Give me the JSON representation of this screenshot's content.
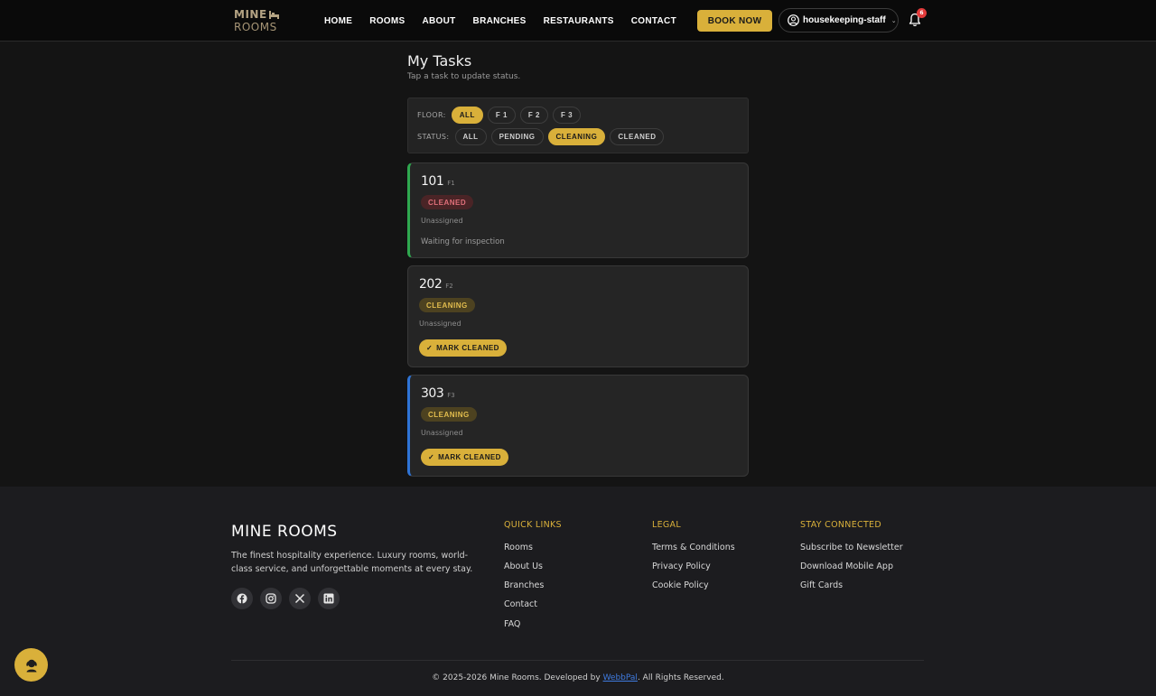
{
  "header": {
    "logo_top": "MINE",
    "logo_bottom": "ROOMS",
    "nav": [
      "HOME",
      "ROOMS",
      "ABOUT",
      "BRANCHES",
      "RESTAURANTS",
      "CONTACT"
    ],
    "book_label": "BOOK NOW",
    "username": "housekeeping-staff",
    "notification_count": "6"
  },
  "main": {
    "title": "My Tasks",
    "subtitle": "Tap a task to update status.",
    "filters": {
      "floor_label": "FLOOR:",
      "floor_options": [
        "ALL",
        "F 1",
        "F 2",
        "F 3"
      ],
      "floor_selected": "ALL",
      "status_label": "STATUS:",
      "status_options": [
        "ALL",
        "PENDING",
        "CLEANING",
        "CLEANED"
      ],
      "status_selected": "CLEANING"
    },
    "tasks": [
      {
        "room": "101",
        "floor": "F1",
        "status": "CLEANED",
        "assignee": "Unassigned",
        "note": "Waiting for inspection",
        "accent": "#2fa84f"
      },
      {
        "room": "202",
        "floor": "F2",
        "status": "CLEANING",
        "assignee": "Unassigned",
        "action": "MARK CLEANED"
      },
      {
        "room": "303",
        "floor": "F3",
        "status": "CLEANING",
        "assignee": "Unassigned",
        "action": "MARK CLEANED",
        "accent": "#2f74d6"
      }
    ]
  },
  "footer": {
    "brand": "MINE ROOMS",
    "description": "The finest hospitality experience. Luxury rooms, world-class service, and unforgettable moments at every stay.",
    "social": [
      "facebook-icon",
      "instagram-icon",
      "x-icon",
      "linkedin-icon"
    ],
    "quick_links_title": "QUICK LINKS",
    "quick_links": [
      "Rooms",
      "About Us",
      "Branches",
      "Contact",
      "FAQ"
    ],
    "legal_title": "LEGAL",
    "legal_links": [
      "Terms & Conditions",
      "Privacy Policy",
      "Cookie Policy"
    ],
    "connect_title": "STAY CONNECTED",
    "connect_links": [
      "Subscribe to Newsletter",
      "Download Mobile App",
      "Gift Cards"
    ],
    "copyright_pre": "© 2025-2026 Mine Rooms. Developed by",
    "developer": "WebbPal",
    "copyright_post": ". All Rights Reserved."
  },
  "colors": {
    "accent": "#d9b03a",
    "cleaned_badge": "#e0707a",
    "cleaning_badge": "#e2bd4e"
  }
}
